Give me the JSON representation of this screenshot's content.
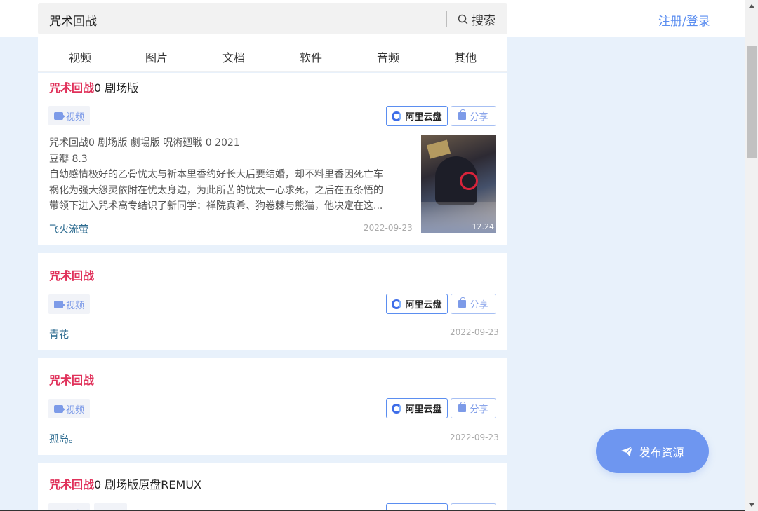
{
  "header": {
    "search_value": "咒术回战",
    "search_button": "搜索",
    "auth_link": "注册/登录"
  },
  "tabs": [
    "视频",
    "图片",
    "文档",
    "软件",
    "音频",
    "其他"
  ],
  "results": [
    {
      "title_highlight": "咒术回战",
      "title_rest": "0 剧场版",
      "tag": "视频",
      "cloud_button": "阿里云盘",
      "share_button": "分享",
      "desc_lines": [
        "咒术回战0 剧场版 劇場版 呪術廻戦 0 2021",
        "豆瓣 8.3",
        "自幼感情极好的乙骨忧太与祈本里香约好长大后要结婚，却不料里香因死亡车",
        "祸化为强大怨灵依附在忧太身边，为此所苦的忧太一心求死，之后在五条悟的",
        "带领下进入咒术高专结识了新同学：禅院真希、狗卷棘与熊猫，他决定在这..."
      ],
      "poster_caption": "12.24",
      "uploader": "飞火流萤",
      "date": "2022-09-23"
    },
    {
      "title_highlight": "咒术回战",
      "title_rest": "",
      "tag": "视频",
      "cloud_button": "阿里云盘",
      "share_button": "分享",
      "uploader": "青花",
      "date": "2022-09-23"
    },
    {
      "title_highlight": "咒术回战",
      "title_rest": "",
      "tag": "视频",
      "cloud_button": "阿里云盘",
      "share_button": "分享",
      "uploader": "孤岛。",
      "date": "2022-09-23"
    },
    {
      "title_highlight": "咒术回战",
      "title_rest": "0 剧场版原盘REMUX",
      "tag": "视频"
    }
  ],
  "fab_label": "发布资源",
  "colors": {
    "accent": "#5b8ef0",
    "highlight": "#e0315a",
    "background": "#e8f1fb"
  }
}
